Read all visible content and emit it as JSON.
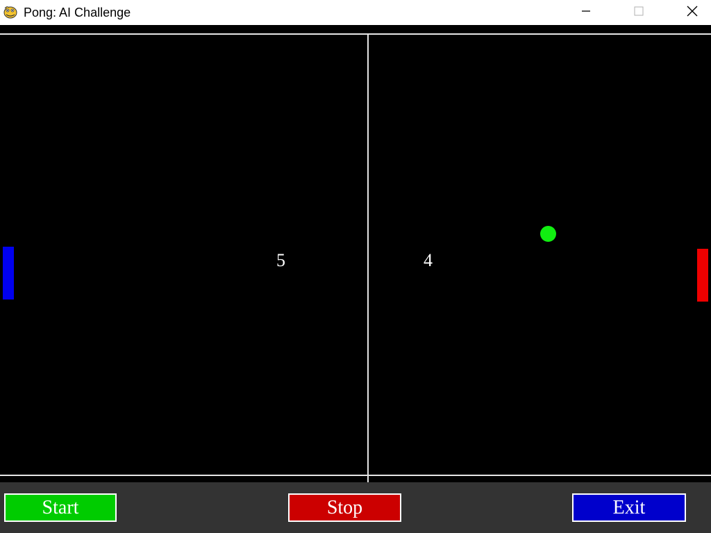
{
  "window": {
    "title": "Pong: AI Challenge",
    "app_icon": "pygame-snake-icon",
    "controls": {
      "minimize_icon": "minimize-icon",
      "maximize_icon": "maximize-icon",
      "close_icon": "close-icon"
    }
  },
  "game": {
    "score_left": "5",
    "score_right": "4",
    "colors": {
      "background": "#000000",
      "court_lines": "#e6e6e6",
      "left_paddle": "#0000ee",
      "right_paddle": "#ee0000",
      "ball": "#11ee11"
    }
  },
  "controls": {
    "start_label": "Start",
    "stop_label": "Stop",
    "exit_label": "Exit",
    "colors": {
      "bar_background": "#333333",
      "start": "#00cc00",
      "stop": "#cc0000",
      "exit": "#0000cc"
    }
  }
}
